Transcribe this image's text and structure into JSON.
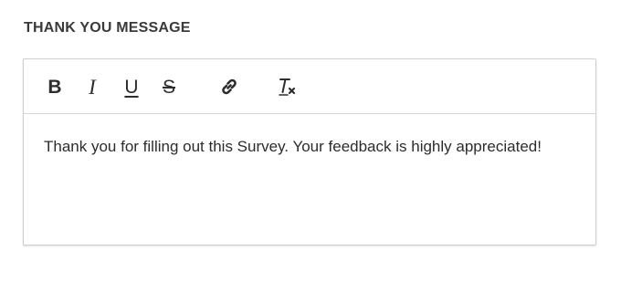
{
  "section": {
    "label": "THANK YOU MESSAGE"
  },
  "toolbar": {
    "bold": {
      "label": "B",
      "icon": "bold-icon"
    },
    "italic": {
      "label": "I",
      "icon": "italic-icon"
    },
    "underline": {
      "label": "U",
      "icon": "underline-icon"
    },
    "strikethrough": {
      "label": "S",
      "icon": "strikethrough-icon"
    },
    "link": {
      "icon": "link-icon"
    },
    "clear_formatting": {
      "icon": "clear-formatting-icon"
    }
  },
  "editor": {
    "content": "Thank you for filling out this Survey. Your feedback is highly appreciated!"
  }
}
